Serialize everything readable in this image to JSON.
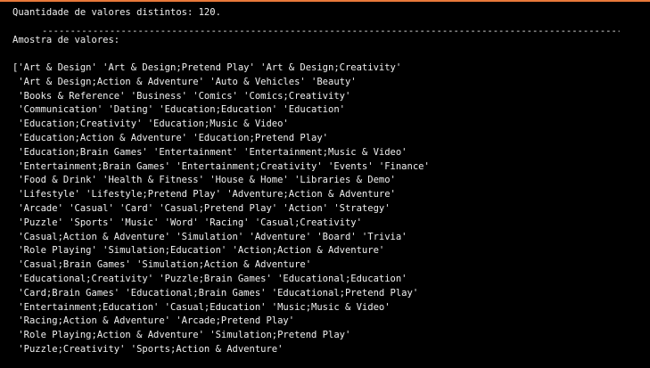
{
  "accent_color": "#e8793a",
  "output": {
    "count_line": "Quantidade de valores distintos: 120.",
    "sample_header": "Amostra de valores:",
    "values_lines": [
      "['Art & Design' 'Art & Design;Pretend Play' 'Art & Design;Creativity'",
      " 'Art & Design;Action & Adventure' 'Auto & Vehicles' 'Beauty'",
      " 'Books & Reference' 'Business' 'Comics' 'Comics;Creativity'",
      " 'Communication' 'Dating' 'Education;Education' 'Education'",
      " 'Education;Creativity' 'Education;Music & Video'",
      " 'Education;Action & Adventure' 'Education;Pretend Play'",
      " 'Education;Brain Games' 'Entertainment' 'Entertainment;Music & Video'",
      " 'Entertainment;Brain Games' 'Entertainment;Creativity' 'Events' 'Finance'",
      " 'Food & Drink' 'Health & Fitness' 'House & Home' 'Libraries & Demo'",
      " 'Lifestyle' 'Lifestyle;Pretend Play' 'Adventure;Action & Adventure'",
      " 'Arcade' 'Casual' 'Card' 'Casual;Pretend Play' 'Action' 'Strategy'",
      " 'Puzzle' 'Sports' 'Music' 'Word' 'Racing' 'Casual;Creativity'",
      " 'Casual;Action & Adventure' 'Simulation' 'Adventure' 'Board' 'Trivia'",
      " 'Role Playing' 'Simulation;Education' 'Action;Action & Adventure'",
      " 'Casual;Brain Games' 'Simulation;Action & Adventure'",
      " 'Educational;Creativity' 'Puzzle;Brain Games' 'Educational;Education'",
      " 'Card;Brain Games' 'Educational;Brain Games' 'Educational;Pretend Play'",
      " 'Entertainment;Education' 'Casual;Education' 'Music;Music & Video'",
      " 'Racing;Action & Adventure' 'Arcade;Pretend Play'",
      " 'Role Playing;Action & Adventure' 'Simulation;Pretend Play'",
      " 'Puzzle;Creativity' 'Sports;Action & Adventure'"
    ]
  }
}
